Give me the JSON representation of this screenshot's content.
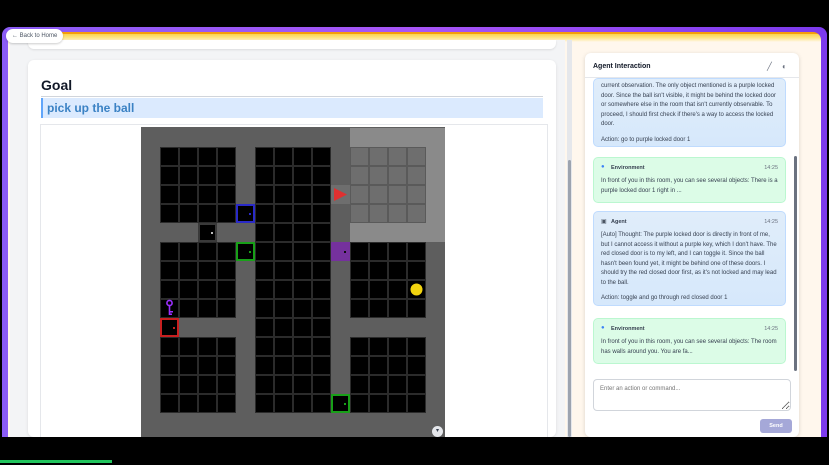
{
  "nav": {
    "back_label": "← Back to Home"
  },
  "goal": {
    "heading": "Goal",
    "mission": "pick up the ball"
  },
  "agent_panel": {
    "title": "Agent Interaction",
    "edit_icon": "pencil-icon",
    "settings_icon": "dot-circle-icon",
    "input_placeholder": "Enter an action or command...",
    "send_label": "Send",
    "messages": [
      {
        "role": "agent",
        "from": "",
        "time": "",
        "text": "current observation. The only object mentioned is a purple locked door. Since the ball isn't visible, it might be behind the locked door or somewhere else in the room that isn't currently observable. To proceed, I should first check if there's a way to access the locked door.",
        "action": "Action: go to purple locked door 1"
      },
      {
        "role": "env",
        "from": "Environment",
        "time": "14:25",
        "text": "In front of you in this room, you can see several objects: There is a purple locked door 1 right in ...",
        "action": ""
      },
      {
        "role": "agent",
        "from": "Agent",
        "time": "14:25",
        "text": "[Auto] Thought: The purple locked door is directly in front of me, but I cannot access it without a purple key, which I don't have. The red closed door is to my left, and I can toggle it. Since the ball hasn't been found yet, it might be behind one of these doors. I should try the red closed door first, as it's not locked and may lead to the ball.",
        "action": "Action: toggle and go through red closed door 1"
      },
      {
        "role": "env",
        "from": "Environment",
        "time": "14:25",
        "text": "In front of you in this room, you can see several objects: The room has walls around you. You are fa...",
        "action": ""
      }
    ]
  },
  "game": {
    "colors": {
      "wall": "#5e5e5e",
      "floor": "#000000",
      "grid": "#2b2b2b",
      "seen_wall": "#8a8a8a",
      "seen_floor": "#6e6e6e"
    },
    "objects": [
      {
        "type": "door",
        "color": "#2a2ac8",
        "state": "closed",
        "icon": "door-icon"
      },
      {
        "type": "door",
        "color": "#3a3a3a",
        "state": "closed",
        "icon": "door-icon"
      },
      {
        "type": "door",
        "color": "#18a018",
        "state": "closed",
        "icon": "door-icon"
      },
      {
        "type": "door",
        "color": "#7a2aa8",
        "state": "locked",
        "icon": "door-icon"
      },
      {
        "type": "door",
        "color": "#c82020",
        "state": "closed",
        "icon": "door-icon"
      },
      {
        "type": "door",
        "color": "#18a018",
        "state": "closed",
        "icon": "door-icon"
      },
      {
        "type": "key",
        "color": "#9b30ff",
        "icon": "key-icon"
      },
      {
        "type": "ball",
        "color": "#f2d40f",
        "icon": "ball-icon"
      },
      {
        "type": "agent",
        "color": "#e03030",
        "direction": "right",
        "icon": "agent-triangle-icon"
      }
    ]
  }
}
